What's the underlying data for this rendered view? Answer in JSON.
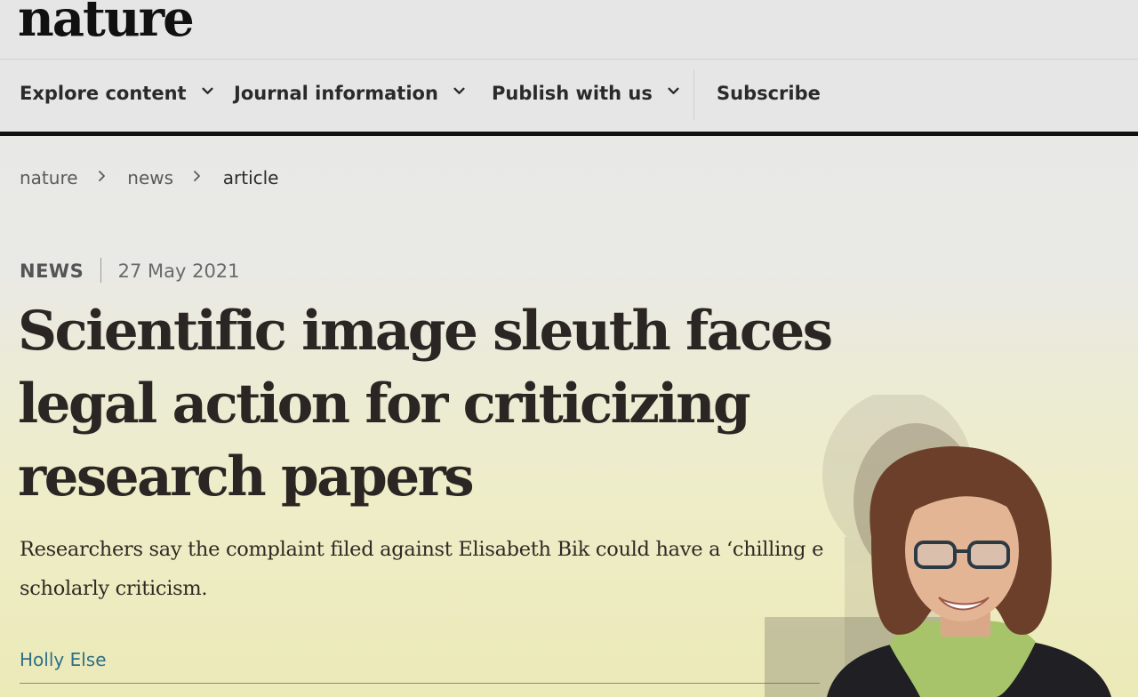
{
  "site": {
    "logo_text": "nature"
  },
  "nav": {
    "items": [
      {
        "label": "Explore content",
        "has_dropdown": true
      },
      {
        "label": "Journal information",
        "has_dropdown": true
      },
      {
        "label": "Publish with us",
        "has_dropdown": true
      },
      {
        "label": "Subscribe",
        "has_dropdown": false
      }
    ]
  },
  "breadcrumb": {
    "items": [
      "nature",
      "news",
      "article"
    ]
  },
  "article": {
    "type": "NEWS",
    "date": "27 May 2021",
    "headline": "Scientific image sleuth faces legal action for criticizing research papers",
    "standfirst": "Researchers say the complaint filed against Elisabeth Bik could have a ‘chilling e",
    "standfirst_line2": "scholarly criticism.",
    "author": "Holly Else"
  },
  "colors": {
    "brand_text": "#111111",
    "headline": "#2b2623",
    "author_link": "#2f6f86",
    "rule": "#111111"
  },
  "icons": {
    "dropdown": "chevron-down-icon",
    "breadcrumb_separator": "chevron-right-icon"
  }
}
